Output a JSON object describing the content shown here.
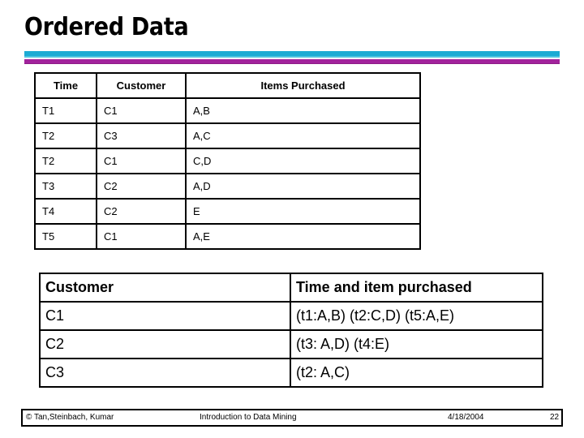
{
  "slide": {
    "title": "Ordered Data"
  },
  "theme": {
    "accent_cyan": "#1cabd4",
    "accent_cyan_light": "#4fc3e0",
    "accent_purple": "#a2239c",
    "accent_purple_dark": "#8e1d88",
    "text": "#000000",
    "background": "#ffffff"
  },
  "transactions_table": {
    "headers": [
      "Time",
      "Customer",
      "Items Purchased"
    ],
    "rows": [
      [
        "T1",
        "C1",
        "A,B"
      ],
      [
        "T2",
        "C3",
        "A,C"
      ],
      [
        "T2",
        "C1",
        "C,D"
      ],
      [
        "T3",
        "C2",
        "A,D"
      ],
      [
        "T4",
        "C2",
        "E"
      ],
      [
        "T5",
        "C1",
        "A,E"
      ]
    ]
  },
  "customer_table": {
    "headers": [
      "Customer",
      "Time and item purchased"
    ],
    "rows": [
      [
        "C1",
        "(t1:A,B) (t2:C,D) (t5:A,E)"
      ],
      [
        "C2",
        "(t3: A,D) (t4:E)"
      ],
      [
        "C3",
        "(t2: A,C)"
      ]
    ]
  },
  "footer": {
    "credit": "© Tan,Steinbach, Kumar",
    "course": "Introduction to Data Mining",
    "date": "4/18/2004",
    "page": "22"
  }
}
